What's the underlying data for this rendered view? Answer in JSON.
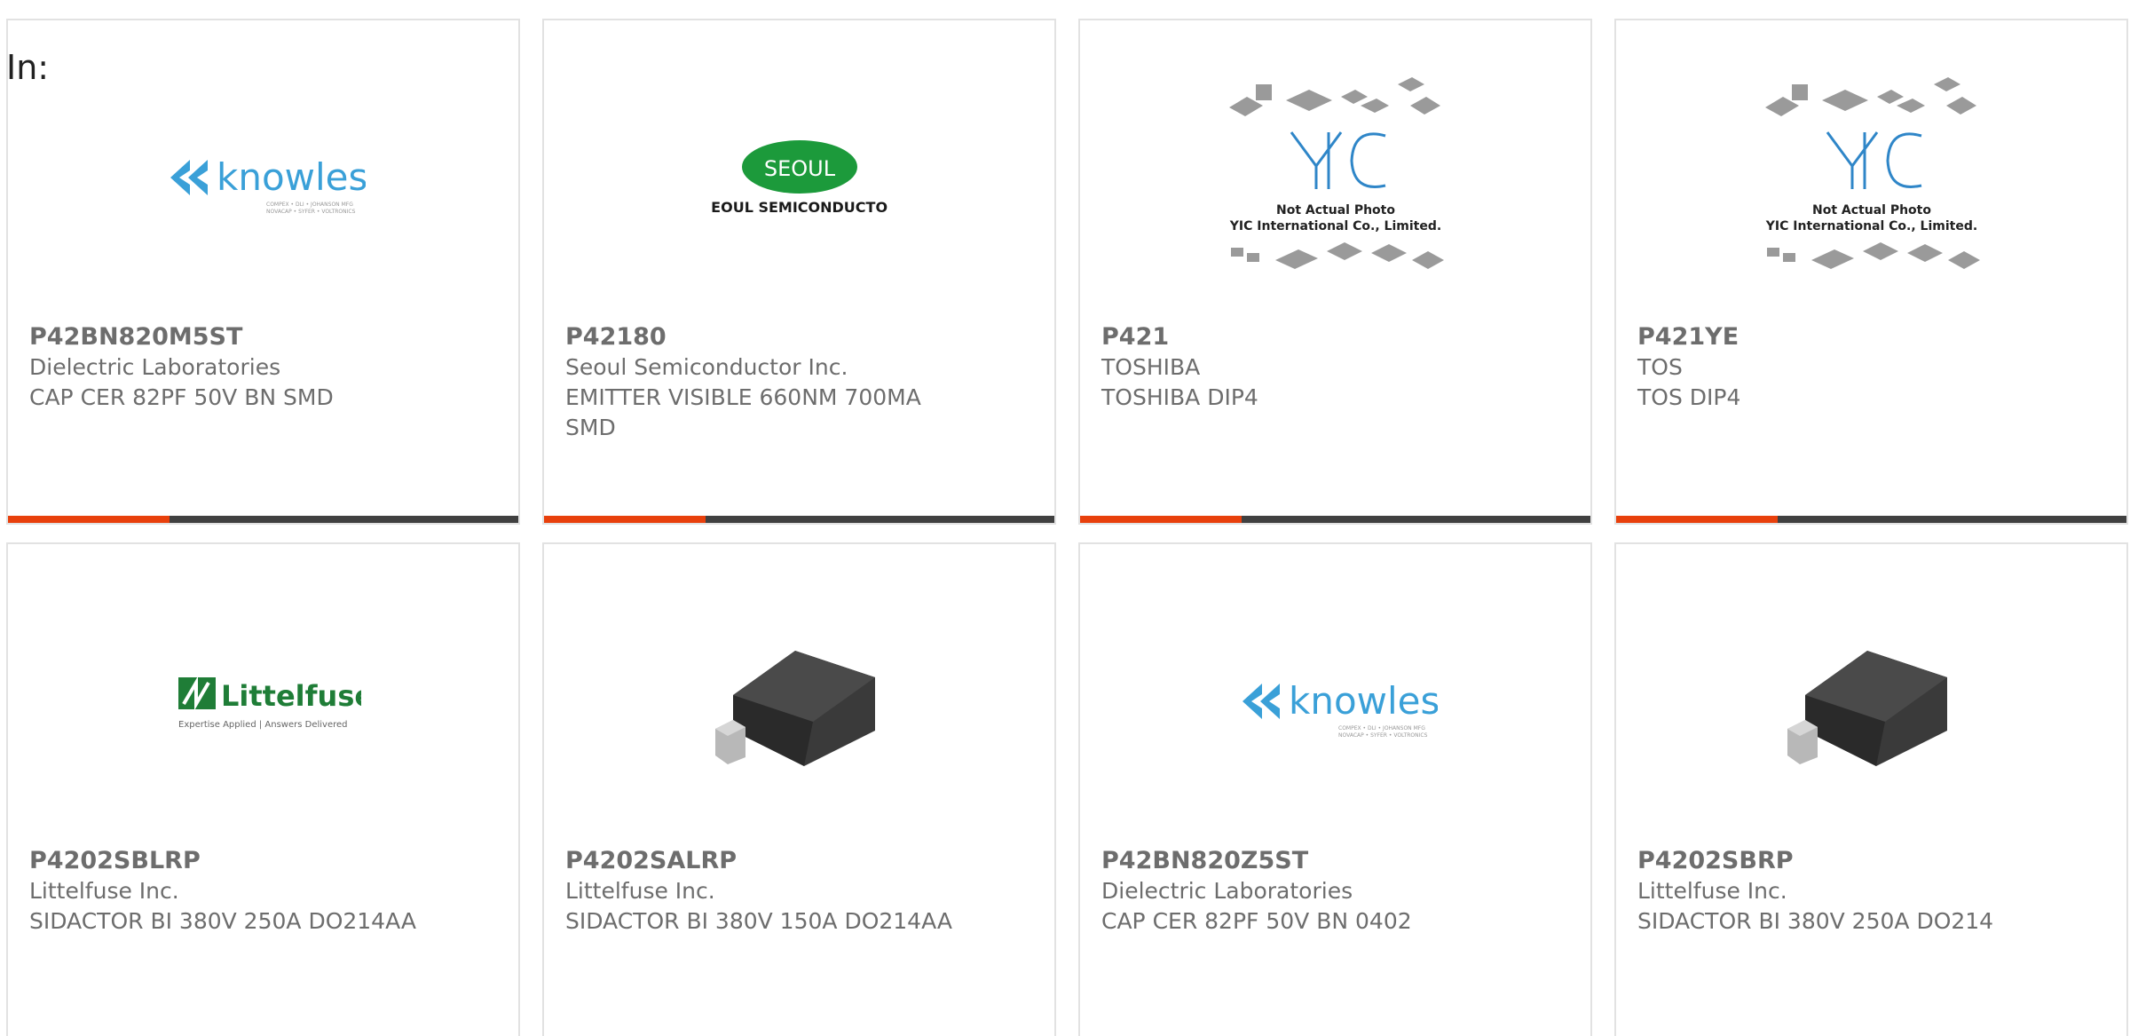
{
  "filter": {
    "label": "In:"
  },
  "products": [
    {
      "part": "P42BN820M5ST",
      "manufacturer": "Dielectric Laboratories",
      "description": "CAP CER 82PF 50V BN SMD",
      "image": "knowles-logo",
      "image_lines": [
        "knowles",
        "COMPEX • DLI • JOHANSON MFG",
        "NOVACAP • SYFER • VOLTRONICS"
      ]
    },
    {
      "part": "P42180",
      "manufacturer": "Seoul Semiconductor Inc.",
      "description": "EMITTER VISIBLE 660NM 700MA SMD",
      "image": "seoul-semiconductor-logo",
      "image_lines": [
        "SEOUL",
        "SEOUL SEMICONDUCTOR"
      ]
    },
    {
      "part": "P421",
      "manufacturer": "TOSHIBA",
      "description": "TOSHIBA DIP4",
      "image": "yic-placeholder",
      "image_lines": [
        "Not Actual Photo",
        "YIC International Co., Limited."
      ]
    },
    {
      "part": "P421YE",
      "manufacturer": "TOS",
      "description": "TOS DIP4",
      "image": "yic-placeholder",
      "image_lines": [
        "Not Actual Photo",
        "YIC International Co., Limited."
      ]
    },
    {
      "part": "P4202SBLRP",
      "manufacturer": "Littelfuse Inc.",
      "description": "SIDACTOR BI 380V 250A DO214AA",
      "image": "littelfuse-logo",
      "image_lines": [
        "Littelfuse",
        "Expertise Applied | Answers Delivered"
      ]
    },
    {
      "part": "P4202SALRP",
      "manufacturer": "Littelfuse Inc.",
      "description": "SIDACTOR BI 380V 150A DO214AA",
      "image": "do214-package",
      "image_lines": []
    },
    {
      "part": "P42BN820Z5ST",
      "manufacturer": "Dielectric Laboratories",
      "description": "CAP CER 82PF 50V BN 0402",
      "image": "knowles-logo",
      "image_lines": [
        "knowles",
        "COMPEX • DLI • JOHANSON MFG",
        "NOVACAP • SYFER • VOLTRONICS"
      ]
    },
    {
      "part": "P4202SBRP",
      "manufacturer": "Littelfuse Inc.",
      "description": "SIDACTOR BI 380V 250A DO214",
      "image": "do214-package",
      "image_lines": []
    }
  ],
  "colors": {
    "accent": "#e8400c",
    "bar": "#404040",
    "text": "#6d6d6d",
    "knowles": "#3aa0d8",
    "seoul": "#1c9a3b",
    "littelfuse": "#1f7d37",
    "yic": "#2f86c8"
  }
}
